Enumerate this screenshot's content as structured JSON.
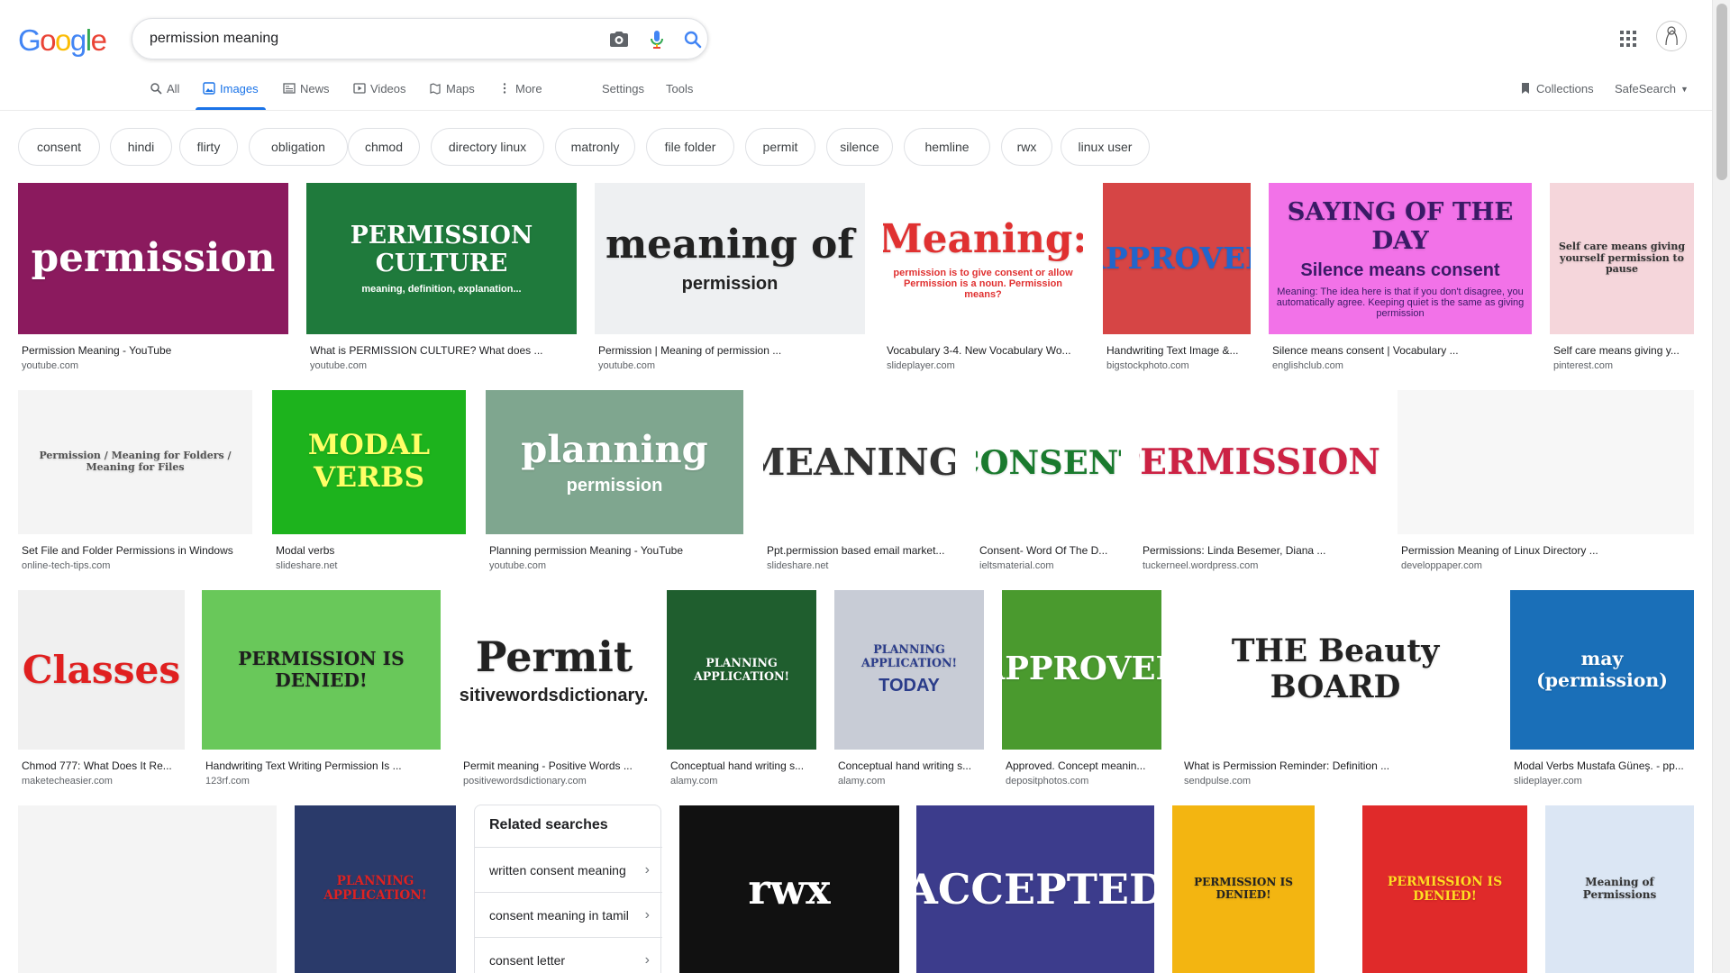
{
  "logo": {
    "letters": [
      "G",
      "o",
      "o",
      "g",
      "l",
      "e"
    ],
    "colors": [
      "#4285f4",
      "#ea4335",
      "#fbbc05",
      "#4285f4",
      "#34a853",
      "#ea4335"
    ]
  },
  "search": {
    "query": "permission meaning"
  },
  "tabs": [
    {
      "label": "All",
      "icon": "search-icon"
    },
    {
      "label": "Images",
      "icon": "image-icon"
    },
    {
      "label": "News",
      "icon": "news-icon"
    },
    {
      "label": "Videos",
      "icon": "video-icon"
    },
    {
      "label": "Maps",
      "icon": "map-icon"
    },
    {
      "label": "More",
      "icon": "more-vertical-icon"
    }
  ],
  "tools": {
    "settings": "Settings",
    "tools": "Tools",
    "collections": "Collections",
    "safesearch": "SafeSearch"
  },
  "chips": [
    "consent",
    "hindi",
    "flirty",
    "obligation",
    "chmod",
    "directory linux",
    "matronly",
    "file folder",
    "permit",
    "silence",
    "hemline",
    "rwx",
    "linux user"
  ],
  "rows": [
    [
      {
        "caption": "Permission Meaning - YouTube",
        "source": "youtube.com",
        "text": "permission",
        "bg": "#8b1a5e",
        "fg": "#ffffff"
      },
      {
        "caption": "What is PERMISSION CULTURE? What does ...",
        "source": "youtube.com",
        "text": "PERMISSION CULTURE",
        "sub": "meaning, definition, explanation...",
        "bg": "#1f7a3c",
        "fg": "#ffffff"
      },
      {
        "caption": "Permission | Meaning of permission ...",
        "source": "youtube.com",
        "text": "meaning of",
        "sub": "permission",
        "bg": "#eef0f2",
        "fg": "#222222"
      },
      {
        "caption": "Vocabulary 3-4. New Vocabulary Wo...",
        "source": "slideplayer.com",
        "text": "Meaning:",
        "sub": "permission is to give consent or allow Permission is a noun. Permission means?",
        "bg": "#ffffff",
        "fg": "#e03131"
      },
      {
        "caption": "Handwriting Text Image &...",
        "source": "bigstockphoto.com",
        "text": "APPROVED",
        "bg": "#d64545",
        "fg": "#2266cc"
      },
      {
        "caption": "Silence means consent | Vocabulary ...",
        "source": "englishclub.com",
        "text": "SAYING OF THE DAY",
        "sub": "Silence means consent",
        "sub2": "Meaning: The idea here is that if you don't disagree, you automatically agree. Keeping quiet is the same as giving permission",
        "bg": "#f272e8",
        "fg": "#3a1a66"
      },
      {
        "caption": "Self care means giving y...",
        "source": "pinterest.com",
        "text": "Self care means giving yourself permission to pause",
        "bg": "#f5d6db",
        "fg": "#333333"
      }
    ],
    [
      {
        "caption": "Set File and Folder Permissions in Windows",
        "source": "online-tech-tips.com",
        "text": "Permission / Meaning for Folders / Meaning for Files",
        "bg": "#f4f4f4",
        "fg": "#555555"
      },
      {
        "caption": "Modal verbs",
        "source": "slideshare.net",
        "text": "MODAL VERBS",
        "bg": "#1db31d",
        "fg": "#ffff66"
      },
      {
        "caption": "Planning permission Meaning - YouTube",
        "source": "youtube.com",
        "text": "planning",
        "sub": "permission",
        "bg": "#7fa68f",
        "fg": "#ffffff"
      },
      {
        "caption": "Ppt.permission based email market...",
        "source": "slideshare.net",
        "text": "MEANING:",
        "bg": "#ffffff",
        "fg": "#333333"
      },
      {
        "caption": "Consent- Word Of The D...",
        "source": "ieltsmaterial.com",
        "text": "CONSENT",
        "bg": "#ffffff",
        "fg": "#1a7a2e"
      },
      {
        "caption": "Permissions: Linda Besemer, Diana ...",
        "source": "tuckerneel.wordpress.com",
        "text": "PERMISSIONS",
        "bg": "#ffffff",
        "fg": "#cc2244"
      },
      {
        "caption": "Permission Meaning of Linux Directory ...",
        "source": "developpaper.com",
        "text": "",
        "bg": "#f7f7f7",
        "fg": "#333333"
      }
    ],
    [
      {
        "caption": "Chmod 777: What Does It Re...",
        "source": "maketecheasier.com",
        "text": "Classes",
        "bg": "#f0f0f0",
        "fg": "#e02020"
      },
      {
        "caption": "Handwriting Text Writing Permission Is ...",
        "source": "123rf.com",
        "text": "PERMISSION IS DENIED!",
        "bg": "#69c85a",
        "fg": "#1e1e1e"
      },
      {
        "caption": "Permit meaning - Positive Words ...",
        "source": "positivewordsdictionary.com",
        "text": "Permit",
        "sub": "©Positivewordsdictionary.com",
        "bg": "#ffffff",
        "fg": "#222222"
      },
      {
        "caption": "Conceptual hand writing s...",
        "source": "alamy.com",
        "text": "PLANNING APPLICATION!",
        "bg": "#1f5e2e",
        "fg": "#ffffff"
      },
      {
        "caption": "Conceptual hand writing s...",
        "source": "alamy.com",
        "text": "PLANNING APPLICATION!",
        "sub": "TODAY",
        "bg": "#c8ccd6",
        "fg": "#2a3c8a"
      },
      {
        "caption": "Approved. Concept meanin...",
        "source": "depositphotos.com",
        "text": "APPROVED",
        "bg": "#4a9a2e",
        "fg": "#ffffff"
      },
      {
        "caption": "What is Permission Reminder: Definition ...",
        "source": "sendpulse.com",
        "text": "THE Beauty BOARD",
        "bg": "#ffffff",
        "fg": "#222222"
      },
      {
        "caption": "Modal Verbs Mustafa Güneş. - pp...",
        "source": "slideplayer.com",
        "text": "may (permission)",
        "bg": "#1a6fb8",
        "fg": "#ffffff"
      }
    ],
    [
      {
        "caption": "",
        "source": "",
        "text": "",
        "bg": "#f4f4f4",
        "fg": "#555555"
      },
      {
        "caption": "",
        "source": "",
        "text": "PLANNING APPLICATION!",
        "bg": "#2a3a6a",
        "fg": "#dd2222"
      },
      {
        "caption": "",
        "source": "",
        "text": "rwx",
        "bg": "#111111",
        "fg": "#ffffff"
      },
      {
        "caption": "",
        "source": "",
        "text": "ACCEPTED",
        "bg": "#3c3c8c",
        "fg": "#ffffff"
      },
      {
        "caption": "",
        "source": "",
        "text": "PERMISSION IS DENIED!",
        "bg": "#f3b511",
        "fg": "#222222"
      },
      {
        "caption": "",
        "source": "",
        "text": "PERMISSION IS DENIED!",
        "bg": "#e02a2a",
        "fg": "#ffdd22"
      },
      {
        "caption": "",
        "source": "",
        "text": "Meaning of Permissions",
        "bg": "#dbe6f4",
        "fg": "#333333"
      }
    ]
  ],
  "related": {
    "title": "Related searches",
    "items": [
      "written consent meaning",
      "consent meaning in tamil",
      "consent letter"
    ]
  }
}
